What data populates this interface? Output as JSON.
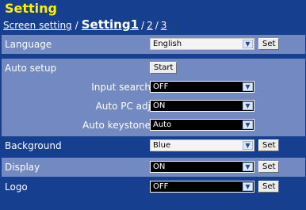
{
  "header": {
    "title": "Setting",
    "crumb_link": "Screen setting",
    "crumb_sep": "/",
    "crumb_current": "Setting1",
    "page1": "1",
    "page_sep": "/",
    "page2": "2",
    "page3": "3"
  },
  "rows": {
    "language": {
      "label": "Language",
      "value": "English",
      "set_label": "Set"
    },
    "auto_setup": {
      "label": "Auto setup",
      "start_label": "Start",
      "input_search": {
        "label": "Input search",
        "value": "OFF"
      },
      "auto_pc_adj": {
        "label": "Auto PC adj",
        "value": "ON"
      },
      "auto_keystone": {
        "label": "Auto keystone",
        "value": "Auto"
      }
    },
    "background": {
      "label": "Background",
      "value": "Blue",
      "set_label": "Set"
    },
    "display": {
      "label": "Display",
      "value": "ON",
      "set_label": "Set"
    },
    "logo": {
      "label": "Logo",
      "value": "OFF",
      "set_label": "Set"
    }
  },
  "colors": {
    "background": "#16408f",
    "row_highlight": "#7289c2",
    "title": "#fff000"
  },
  "icons": {
    "dropdown_arrow": "chevron-down-icon"
  }
}
